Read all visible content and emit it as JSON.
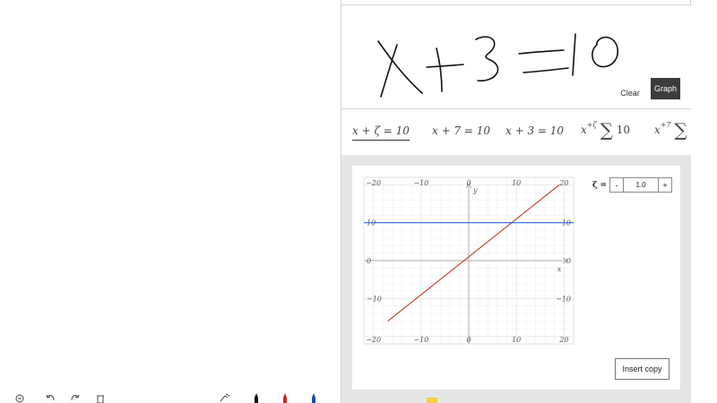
{
  "ink_panel": {
    "clear_label": "Clear",
    "graph_label": "Graph",
    "ink_text": "x+3=10"
  },
  "suggestions": [
    {
      "base": "x + ζ = 10",
      "selected": true
    },
    {
      "base": "x + 7 = 10",
      "selected": false
    },
    {
      "base": "x + 3 = 10",
      "selected": false
    },
    {
      "base": "x",
      "sup": "+ζ",
      "sigma": "∑",
      "tail": "10",
      "selected": false
    },
    {
      "base": "x",
      "sup": "+7",
      "sigma": "∑",
      "tail": "",
      "selected": false
    }
  ],
  "parameter": {
    "label": "ζ =",
    "minus_label": "-",
    "value": "1.0",
    "plus_label": "+"
  },
  "insert_copy_label": "Insert copy",
  "colors": {
    "line_red": "#c0392b",
    "line_blue": "#2e6bd6",
    "graph_button_bg": "#3c3c3c",
    "grid": "#e8e8e8"
  },
  "toolbar_icons": [
    "zoom-out-icon",
    "undo-icon",
    "redo-icon",
    "delete-icon",
    "touch-writing-icon",
    "pen-black-icon",
    "pen-red-icon",
    "pen-blue-icon",
    "highlighter-yellow-icon"
  ],
  "chart_data": {
    "type": "line",
    "xlim": [
      -22,
      22
    ],
    "ylim": [
      -22,
      22
    ],
    "xlabel": "x",
    "ylabel": "y",
    "x_ticks": [
      -20,
      -10,
      0,
      10,
      20
    ],
    "y_ticks": [
      -20,
      -10,
      0,
      10,
      20
    ],
    "x_tick_labels": [
      "−20",
      "−10",
      "0",
      "10",
      "20"
    ],
    "y_tick_labels": [
      "−20",
      "−10",
      "0",
      "10",
      "20"
    ],
    "grid": true,
    "series": [
      {
        "color": "#c0392b",
        "x": [
          -17,
          19
        ],
        "y": [
          -16,
          20
        ]
      },
      {
        "color": "#2e6bd6",
        "x": [
          -22,
          22
        ],
        "y": [
          10,
          10
        ]
      }
    ]
  }
}
